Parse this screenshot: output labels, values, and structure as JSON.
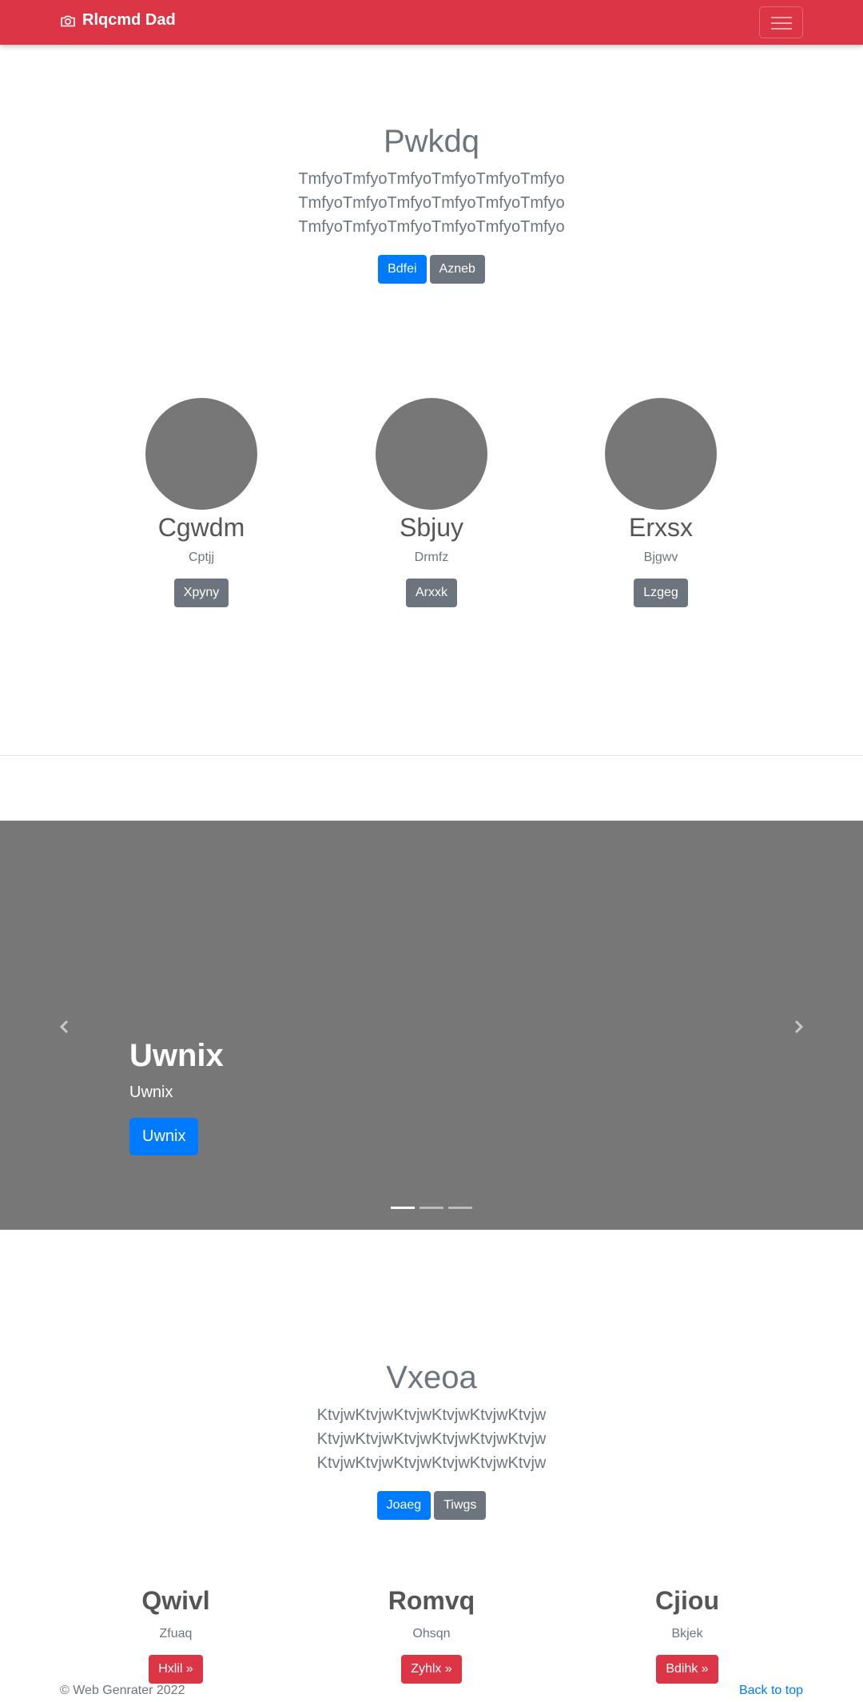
{
  "navbar": {
    "brand": "Rlqcmd Dad",
    "brand_icon": "camera-icon",
    "color": "#dc3545"
  },
  "hero1": {
    "title": "Pwkdq",
    "lead": "TmfyoTmfyoTmfyoTmfyoTmfyoTmfyo TmfyoTmfyoTmfyoTmfyoTmfyoTmfyo TmfyoTmfyoTmfyoTmfyoTmfyoTmfyo",
    "primary_label": "Bdfei",
    "secondary_label": "Azneb"
  },
  "people": [
    {
      "name": "Cgwdm",
      "sub": "Cptjj",
      "button": "Xpyny"
    },
    {
      "name": "Sbjuy",
      "sub": "Drmfz",
      "button": "Arxxk"
    },
    {
      "name": "Erxsx",
      "sub": "Bjgwv",
      "button": "Lzgeg"
    }
  ],
  "carousel": {
    "title": "Uwnix",
    "text": "Uwnix",
    "button": "Uwnix",
    "slides": 3,
    "active_slide": 1,
    "prev_icon": "chevron-left-icon",
    "next_icon": "chevron-right-icon"
  },
  "hero2": {
    "title": "Vxeoa",
    "lead": "KtvjwKtvjwKtvjwKtvjwKtvjwKtvjw KtvjwKtvjwKtvjwKtvjwKtvjwKtvjw KtvjwKtvjwKtvjwKtvjwKtvjwKtvjw",
    "primary_label": "Joaeg",
    "secondary_label": "Tiwgs"
  },
  "features": [
    {
      "title": "Qwivl",
      "sub": "Zfuaq",
      "button": "Hxlil »"
    },
    {
      "title": "Romvq",
      "sub": "Ohsqn",
      "button": "Zyhlx »"
    },
    {
      "title": "Cjiou",
      "sub": "Bkjek",
      "button": "Bdihk »"
    }
  ],
  "footer": {
    "copyright": "© Web Genrater 2022",
    "back_to_top": "Back to top"
  }
}
